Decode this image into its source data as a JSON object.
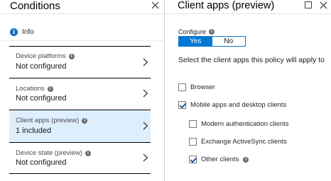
{
  "left_blade": {
    "title": "Conditions",
    "info_label": "Info",
    "items": [
      {
        "label": "Device platforms",
        "value": "Not configured",
        "selected": false
      },
      {
        "label": "Locations",
        "value": "Not configured",
        "selected": false
      },
      {
        "label": "Client apps (preview)",
        "value": "1 included",
        "selected": true
      },
      {
        "label": "Device state (preview)",
        "value": "Not configured",
        "selected": false
      }
    ]
  },
  "right_blade": {
    "title": "Client apps (preview)",
    "configure_label": "Configure",
    "toggle": {
      "yes": "Yes",
      "no": "No",
      "selected": "Yes"
    },
    "instruction": "Select the client apps this policy will apply to",
    "options": [
      {
        "label": "Browser",
        "checked": false
      },
      {
        "label": "Mobile apps and desktop clients",
        "checked": true
      },
      {
        "label": "Modern authentication clients",
        "checked": false
      },
      {
        "label": "Exchange ActiveSync clients",
        "checked": false
      },
      {
        "label": "Other clients",
        "checked": true,
        "has_info": true
      }
    ]
  },
  "colors": {
    "accent": "#0078d4",
    "selected_row": "#ddeefc",
    "info_icon": "#0f6ebd"
  }
}
